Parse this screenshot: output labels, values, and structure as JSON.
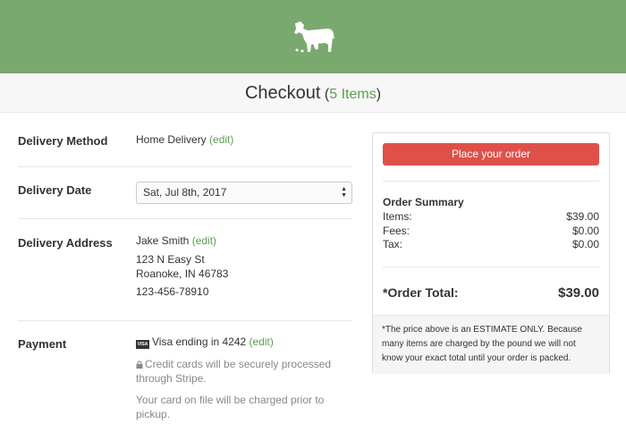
{
  "header": {
    "title": "Checkout",
    "count_open": "(",
    "count": "5 Items",
    "count_close": ")"
  },
  "delivery_method": {
    "label": "Delivery Method",
    "value": "Home Delivery",
    "edit": "(edit)"
  },
  "delivery_date": {
    "label": "Delivery Date",
    "selected": "Sat, Jul 8th, 2017"
  },
  "delivery_address": {
    "label": "Delivery Address",
    "name": "Jake Smith",
    "edit": "(edit)",
    "street": "123 N Easy St",
    "city": "Roanoke, IN 46783",
    "phone": "123-456-78910"
  },
  "payment": {
    "label": "Payment",
    "card_badge": "VISA",
    "card": "Visa ending in 4242",
    "edit": "(edit)",
    "secure_line1": "Credit cards will be securely processed",
    "secure_line2": "through Stripe.",
    "charge_line1": "Your card on file will be charged prior to",
    "charge_line2": "pickup."
  },
  "summary": {
    "place_order": "Place your order",
    "title": "Order Summary",
    "items_label": "Items:",
    "items_value": "$39.00",
    "fees_label": "Fees:",
    "fees_value": "$0.00",
    "tax_label": "Tax:",
    "tax_value": "$0.00",
    "total_label": "*Order Total:",
    "total_value": "$39.00",
    "note_line1": "*The price above is an ESTIMATE ONLY. Because",
    "note_line2": "many items are charged by the pound we will not",
    "note_line3": "know your exact total until your order is packed."
  },
  "colors": {
    "brand": "#7aa96f",
    "accent_link": "#5e9c53",
    "primary_button": "#e0504a"
  },
  "icons": {
    "logo": "cow-logo-icon",
    "lock": "lock-icon",
    "card": "visa-card-icon",
    "select": "select-arrows-icon"
  }
}
